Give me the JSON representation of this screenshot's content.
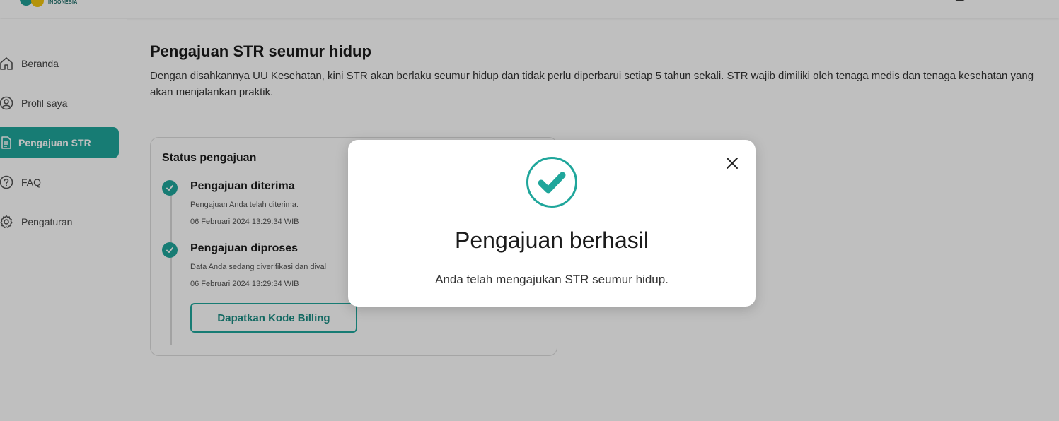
{
  "header": {
    "logo_text": "INDONESIA"
  },
  "sidebar": {
    "items": [
      {
        "label": "Beranda",
        "icon": "home-icon"
      },
      {
        "label": "Profil saya",
        "icon": "user-icon"
      },
      {
        "label": "Pengajuan STR",
        "icon": "document-icon",
        "active": true
      },
      {
        "label": "FAQ",
        "icon": "question-icon"
      },
      {
        "label": "Pengaturan",
        "icon": "gear-icon"
      }
    ]
  },
  "main": {
    "title": "Pengajuan STR seumur hidup",
    "description": "Dengan disahkannya UU Kesehatan, kini STR akan berlaku seumur hidup dan tidak perlu diperbarui setiap 5 tahun sekali. STR wajib dimiliki oleh tenaga medis dan tenaga kesehatan yang akan menjalankan praktik."
  },
  "status": {
    "title": "Status pengajuan",
    "steps": [
      {
        "title": "Pengajuan diterima",
        "desc": "Pengajuan Anda telah diterima.",
        "time": "06 Februari 2024 13:29:34 WIB"
      },
      {
        "title": "Pengajuan diproses",
        "desc": "Data Anda sedang diverifikasi dan dival",
        "time": "06 Februari 2024 13:29:34 WIB"
      }
    ],
    "billing_button": "Dapatkan Kode Billing"
  },
  "modal": {
    "title": "Pengajuan berhasil",
    "message": "Anda telah mengajukan STR seumur hidup."
  },
  "colors": {
    "accent": "#1fa69b",
    "overlay": "rgba(0,0,0,0.25)"
  }
}
